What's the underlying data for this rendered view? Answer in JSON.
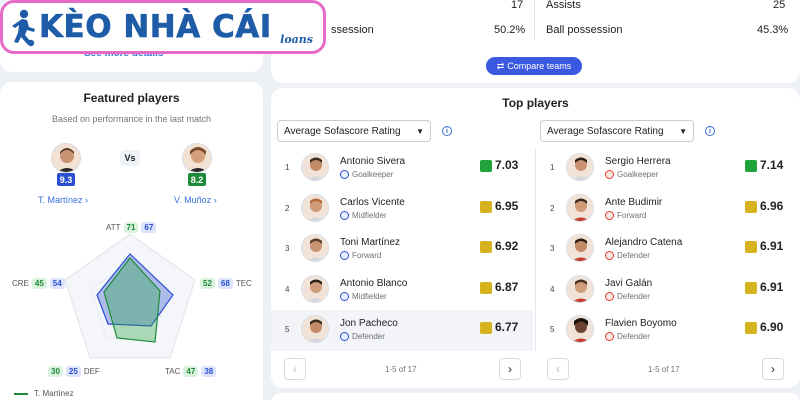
{
  "logo": {
    "title": "KÈO NHÀ CÁI",
    "subtitle": "loans"
  },
  "left_top": {
    "see_more": "See more details"
  },
  "stats": {
    "left_col": [
      {
        "label": "Assists",
        "home": "17"
      },
      {
        "label": "Ball possession",
        "home": "50.2%"
      }
    ],
    "right_col": [
      {
        "label": "Assists",
        "away": "25"
      },
      {
        "label": "Ball possession",
        "away": "45.3%"
      }
    ],
    "compare_btn": "Compare teams"
  },
  "featured": {
    "title": "Featured players",
    "subtitle": "Based on performance in the last match",
    "vs": "Vs",
    "home": {
      "name": "T. Martínez",
      "rating": "9.3",
      "color": "#2c4fd1"
    },
    "away": {
      "name": "V. Muñoz",
      "rating": "8.2",
      "color": "#1d8a3a"
    },
    "attributes": [
      {
        "axis": "ATT",
        "home": "71",
        "away": "67"
      },
      {
        "axis": "TEC",
        "home": "52",
        "away": "68"
      },
      {
        "axis": "TAC",
        "home": "47",
        "away": "38"
      },
      {
        "axis": "DEF",
        "home": "30",
        "away": "25"
      },
      {
        "axis": "CRE",
        "home": "45",
        "away": "54"
      }
    ],
    "legend_home": "T. Martínez"
  },
  "top_players": {
    "title": "Top players",
    "left": {
      "dropdown": "Average Sofascore Rating",
      "team_color": "#2c4fd1",
      "players": [
        {
          "rank": "1",
          "name": "Antonio Sivera",
          "pos": "Goalkeeper",
          "rating": "7.03",
          "rating_color": "#21a33b"
        },
        {
          "rank": "2",
          "name": "Carlos Vicente",
          "pos": "Midfielder",
          "rating": "6.95",
          "rating_color": "#d6b21e"
        },
        {
          "rank": "3",
          "name": "Toni Martínez",
          "pos": "Forward",
          "rating": "6.92",
          "rating_color": "#d6b21e"
        },
        {
          "rank": "4",
          "name": "Antonio Blanco",
          "pos": "Midfielder",
          "rating": "6.87",
          "rating_color": "#d6b21e"
        },
        {
          "rank": "5",
          "name": "Jon Pacheco",
          "pos": "Defender",
          "rating": "6.77",
          "rating_color": "#d6b21e"
        }
      ],
      "pager": "1-5 of 17"
    },
    "right": {
      "dropdown": "Average Sofascore Rating",
      "team_color": "#e23a2b",
      "players": [
        {
          "rank": "1",
          "name": "Sergio Herrera",
          "pos": "Goalkeeper",
          "rating": "7.14",
          "rating_color": "#21a33b"
        },
        {
          "rank": "2",
          "name": "Ante Budimir",
          "pos": "Forward",
          "rating": "6.96",
          "rating_color": "#d6b21e"
        },
        {
          "rank": "3",
          "name": "Alejandro Catena",
          "pos": "Defender",
          "rating": "6.91",
          "rating_color": "#d6b21e"
        },
        {
          "rank": "4",
          "name": "Javi Galán",
          "pos": "Defender",
          "rating": "6.91",
          "rating_color": "#d6b21e"
        },
        {
          "rank": "5",
          "name": "Flavien Boyomo",
          "pos": "Defender",
          "rating": "6.90",
          "rating_color": "#d6b21e"
        }
      ],
      "pager": "1-5 of 17"
    }
  }
}
